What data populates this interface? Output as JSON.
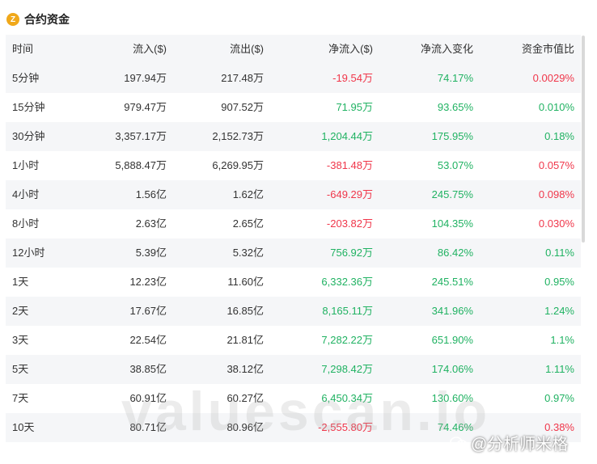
{
  "header": {
    "icon": "coin-icon",
    "title": "合约资金"
  },
  "table": {
    "columns": [
      "时间",
      "流入($)",
      "流出($)",
      "净流入($)",
      "净流入变化",
      "资金市值比"
    ],
    "rows": [
      [
        "5分钟",
        "197.94万",
        "217.48万",
        "-19.54万",
        "74.17%",
        "0.0029%"
      ],
      [
        "15分钟",
        "979.47万",
        "907.52万",
        "71.95万",
        "93.65%",
        "0.010%"
      ],
      [
        "30分钟",
        "3,357.17万",
        "2,152.73万",
        "1,204.44万",
        "175.95%",
        "0.18%"
      ],
      [
        "1小时",
        "5,888.47万",
        "6,269.95万",
        "-381.48万",
        "53.07%",
        "0.057%"
      ],
      [
        "4小时",
        "1.56亿",
        "1.62亿",
        "-649.29万",
        "245.75%",
        "0.098%"
      ],
      [
        "8小时",
        "2.63亿",
        "2.65亿",
        "-203.82万",
        "104.35%",
        "0.030%"
      ],
      [
        "12小时",
        "5.39亿",
        "5.32亿",
        "756.92万",
        "86.42%",
        "0.11%"
      ],
      [
        "1天",
        "12.23亿",
        "11.60亿",
        "6,332.36万",
        "245.51%",
        "0.95%"
      ],
      [
        "2天",
        "17.67亿",
        "16.85亿",
        "8,165.11万",
        "341.96%",
        "1.24%"
      ],
      [
        "3天",
        "22.54亿",
        "21.81亿",
        "7,282.22万",
        "651.90%",
        "1.1%"
      ],
      [
        "5天",
        "38.85亿",
        "38.12亿",
        "7,298.42万",
        "174.06%",
        "1.11%"
      ],
      [
        "7天",
        "60.91亿",
        "60.27亿",
        "6,450.34万",
        "130.60%",
        "0.97%"
      ],
      [
        "10天",
        "80.71亿",
        "80.96亿",
        "-2,555.80万",
        "74.46%",
        "0.38%"
      ]
    ],
    "colors": {
      "positive": "#20b262",
      "negative": "#f0364a"
    }
  },
  "watermark": "valuescan.io",
  "author": "@分析师米格"
}
